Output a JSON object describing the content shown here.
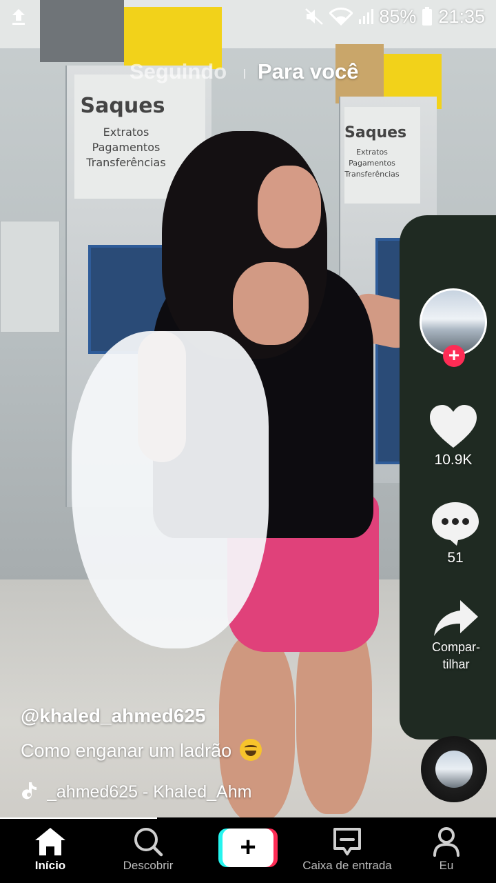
{
  "status_bar": {
    "battery": "85%",
    "time": "21:35"
  },
  "top_tabs": {
    "following": "Seguindo",
    "for_you": "Para você"
  },
  "background_signs": {
    "left_title": "Saques",
    "left_lines": [
      "Extratos",
      "Pagamentos",
      "Transferências"
    ],
    "right_title": "Saques",
    "right_lines": [
      "Extratos",
      "Pagamentos",
      "Transferências"
    ]
  },
  "rail": {
    "likes": "10.9K",
    "comments": "51",
    "share_line1": "Compar-",
    "share_line2": "tilhar"
  },
  "post": {
    "username": "@khaled_ahmed625",
    "caption": "Como enganar um ladrão",
    "caption_emoji": "rolling-on-floor-laughing-emoji",
    "music": "_ahmed625 - Khaled_Ahm"
  },
  "bottom_nav": {
    "home": "Início",
    "discover": "Descobrir",
    "inbox": "Caixa de entrada",
    "me": "Eu"
  },
  "colors": {
    "accent_red": "#fe2c55",
    "accent_cyan": "#25f4ee",
    "nav_background": "#000000"
  }
}
